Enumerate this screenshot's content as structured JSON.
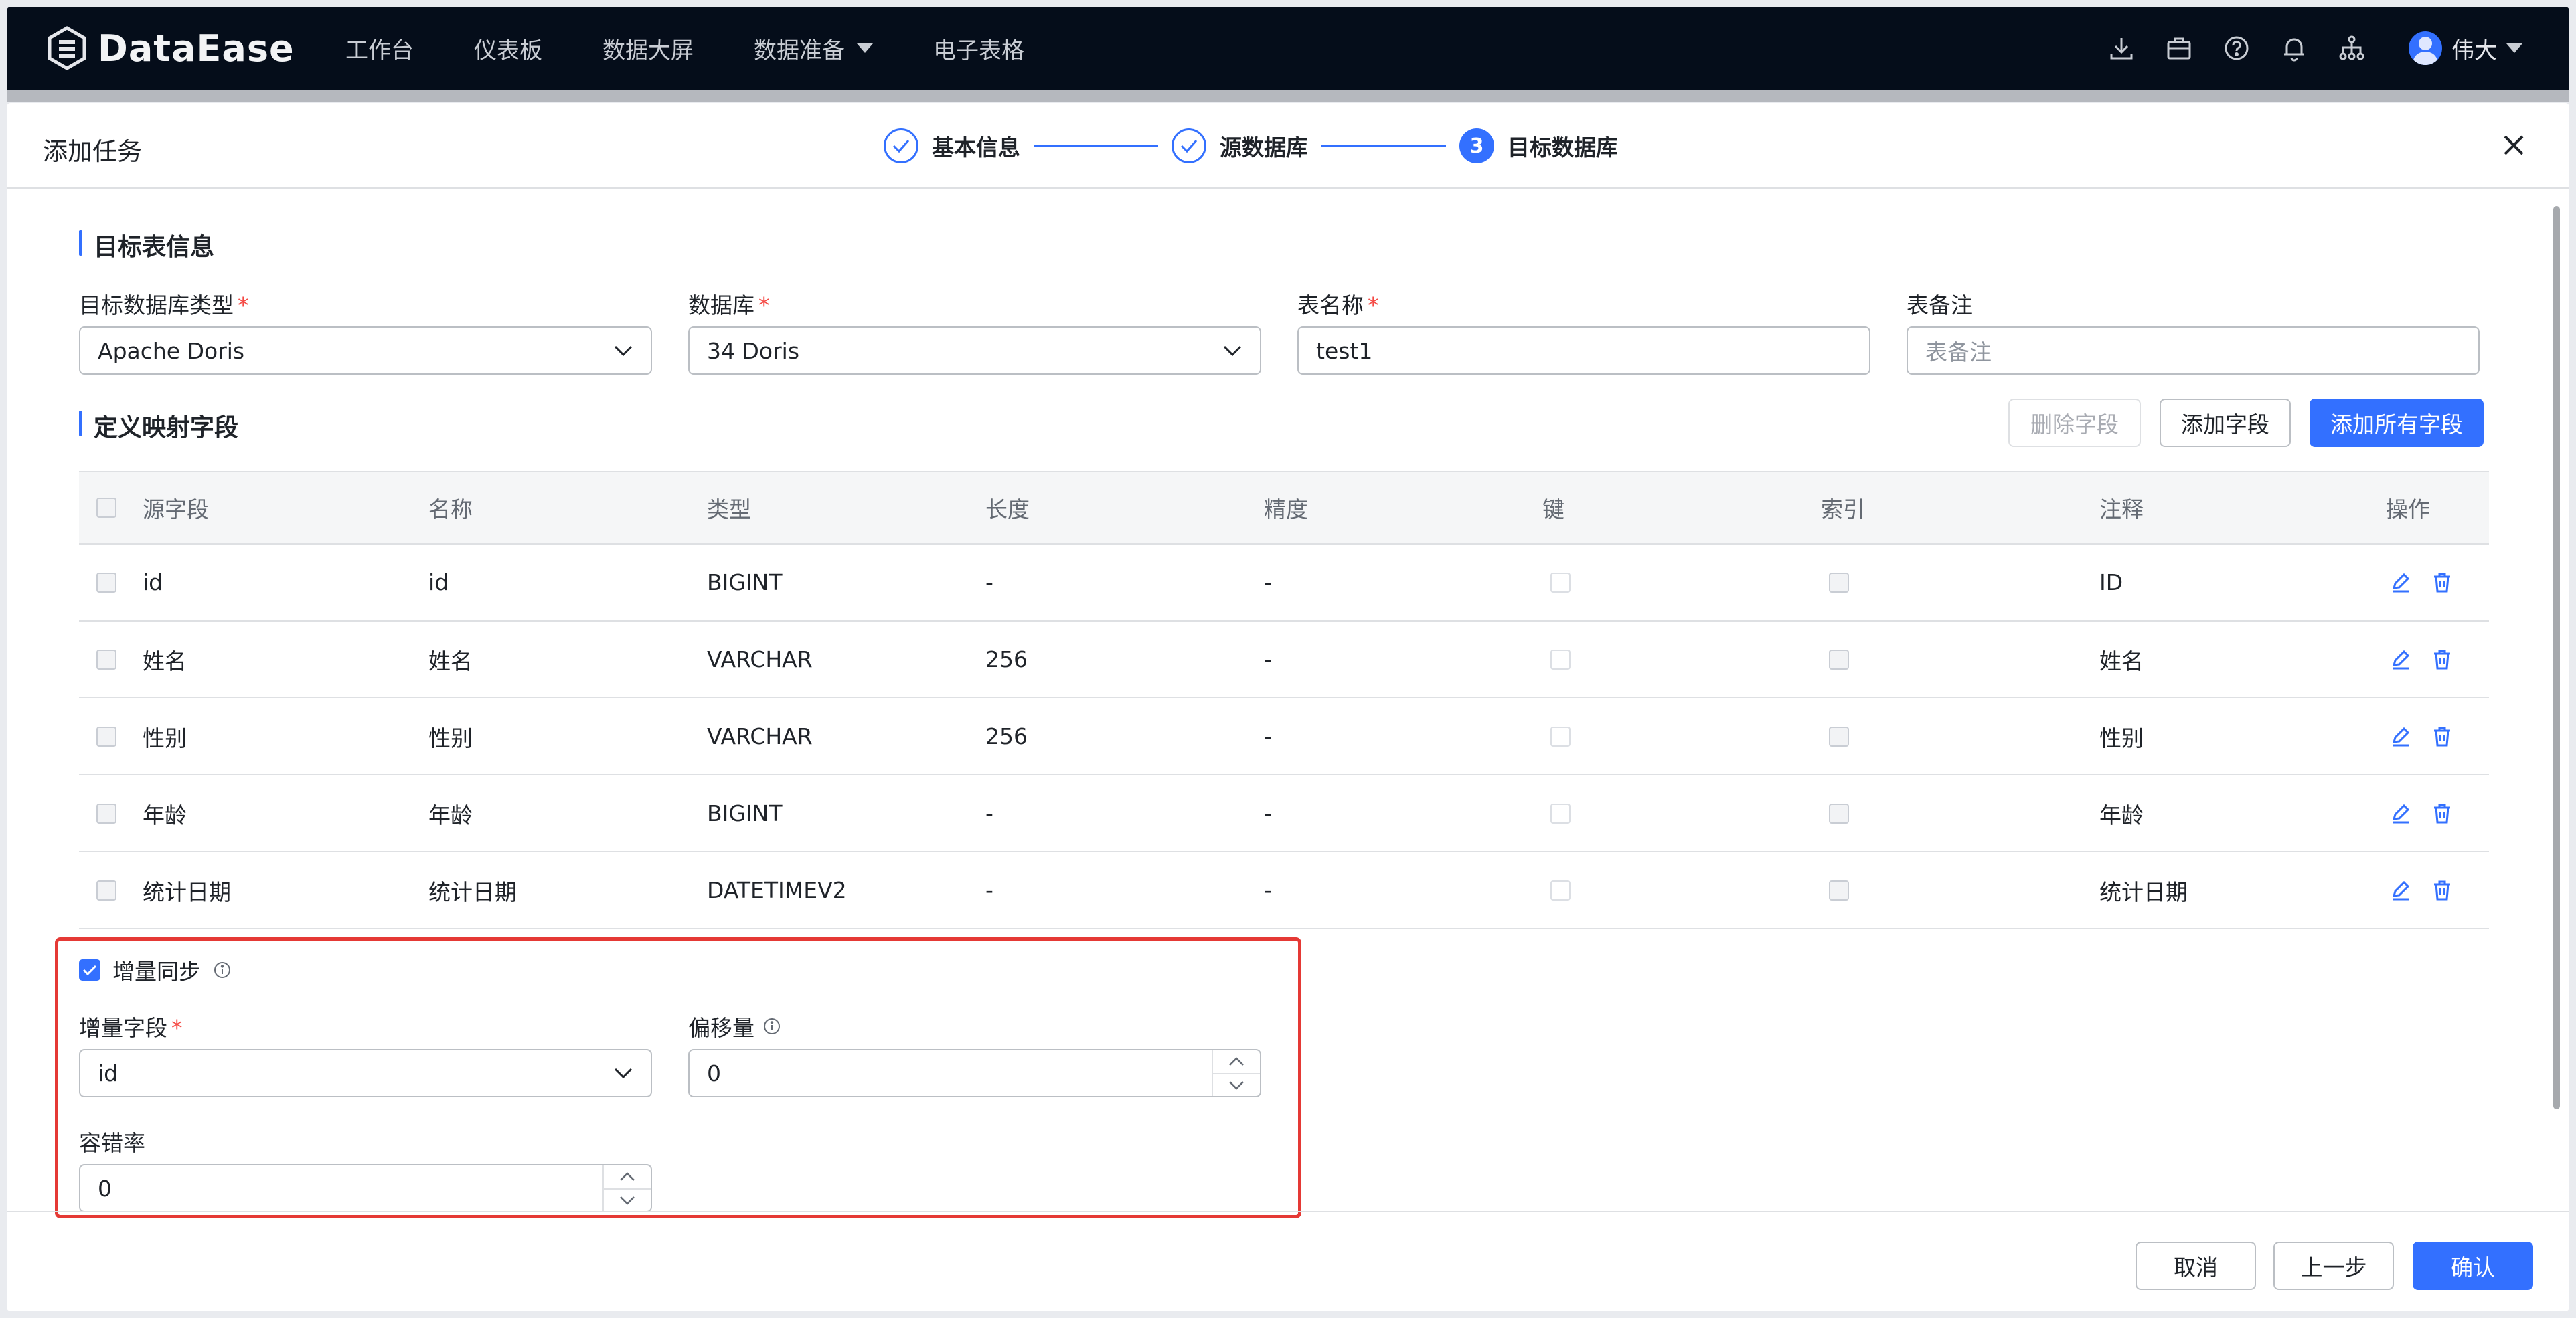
{
  "app": {
    "logo_text": "DataEase",
    "nav": [
      {
        "label": "工作台"
      },
      {
        "label": "仪表板"
      },
      {
        "label": "数据大屏"
      },
      {
        "label": "数据准备"
      },
      {
        "label": "电子表格"
      }
    ],
    "user_name": "伟大"
  },
  "drawer": {
    "title": "添加任务",
    "steps": [
      {
        "label": "基本信息",
        "state": "done"
      },
      {
        "label": "源数据库",
        "state": "done"
      },
      {
        "label": "目标数据库",
        "state": "active",
        "number": "3"
      }
    ]
  },
  "target": {
    "section_title": "目标表信息",
    "db_type_label": "目标数据库类型",
    "db_type_value": "Apache Doris",
    "db_label": "数据库",
    "db_value": "34 Doris",
    "table_name_label": "表名称",
    "table_name_value": "test1",
    "remark_label": "表备注",
    "remark_placeholder": "表备注"
  },
  "mapping": {
    "section_title": "定义映射字段",
    "delete_btn": "删除字段",
    "add_btn": "添加字段",
    "add_all_btn": "添加所有字段",
    "columns": [
      "源字段",
      "名称",
      "类型",
      "长度",
      "精度",
      "键",
      "索引",
      "注释",
      "操作"
    ],
    "rows": [
      {
        "source": "id",
        "name": "id",
        "type": "BIGINT",
        "length": "-",
        "precision": "-",
        "comment": "ID"
      },
      {
        "source": "姓名",
        "name": "姓名",
        "type": "VARCHAR",
        "length": "256",
        "precision": "-",
        "comment": "姓名"
      },
      {
        "source": "性别",
        "name": "性别",
        "type": "VARCHAR",
        "length": "256",
        "precision": "-",
        "comment": "性别"
      },
      {
        "source": "年龄",
        "name": "年龄",
        "type": "BIGINT",
        "length": "-",
        "precision": "-",
        "comment": "年龄"
      },
      {
        "source": "统计日期",
        "name": "统计日期",
        "type": "DATETIMEV2",
        "length": "-",
        "precision": "-",
        "comment": "统计日期"
      }
    ]
  },
  "incremental": {
    "checkbox_label": "增量同步",
    "checked": true,
    "field_label": "增量字段",
    "field_value": "id",
    "offset_label": "偏移量",
    "offset_value": "0",
    "fault_label": "容错率",
    "fault_value": "0"
  },
  "footer": {
    "cancel": "取消",
    "prev": "上一步",
    "confirm": "确认"
  },
  "colors": {
    "accent": "#3370ff",
    "highlight": "#e53935",
    "topbar": "#050d1a"
  }
}
